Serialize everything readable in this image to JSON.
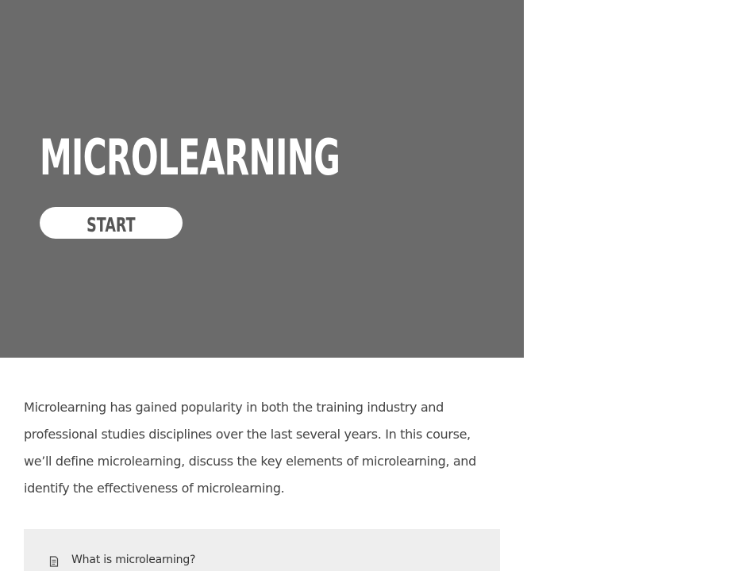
{
  "hero": {
    "title": "Microlearning",
    "start_label": "Start"
  },
  "description": "Microlearning has gained popularity in both the training industry and professional studies disciplines over the last several years. In this course, we’ll define microlearning, discuss the key elements of microlearning, and identify the effectiveness of microlearning.",
  "lessons": [
    {
      "label": "What is microlearning?",
      "icon": "document-icon"
    }
  ],
  "colors": {
    "hero_background": "#6b6b6b",
    "hero_text": "#ffffff",
    "button_background": "#ffffff",
    "button_text": "#555555",
    "body_text": "#444444",
    "lesson_panel_background": "#eeeeee"
  }
}
